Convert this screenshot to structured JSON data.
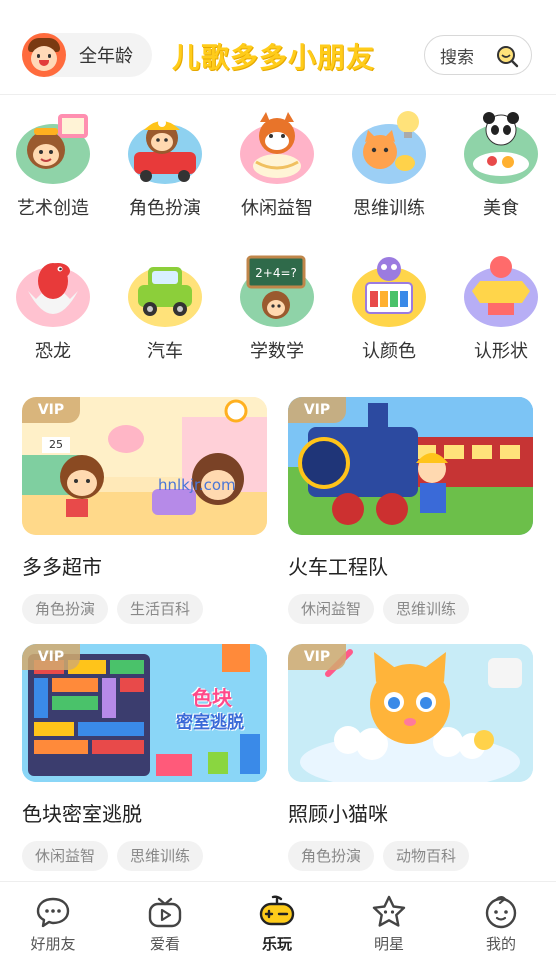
{
  "header": {
    "age_label": "全年龄",
    "app_title": "儿歌多多小朋友",
    "search_label": "搜索"
  },
  "categories": [
    {
      "label": "艺术创造",
      "icon": "monkey-painting-icon"
    },
    {
      "label": "角色扮演",
      "icon": "monkey-firefighter-icon"
    },
    {
      "label": "休闲益智",
      "icon": "red-panda-noodles-icon"
    },
    {
      "label": "思维训练",
      "icon": "cat-lightbulb-icon"
    },
    {
      "label": "美食",
      "icon": "panda-food-icon"
    },
    {
      "label": "恐龙",
      "icon": "dinosaur-egg-icon"
    },
    {
      "label": "汽车",
      "icon": "green-car-icon"
    },
    {
      "label": "学数学",
      "icon": "math-board-icon"
    },
    {
      "label": "认颜色",
      "icon": "color-palette-icon"
    },
    {
      "label": "认形状",
      "icon": "shapes-robot-icon"
    }
  ],
  "cards": [
    {
      "title": "多多超市",
      "badge": "VIP",
      "tags": [
        "角色扮演",
        "生活百科"
      ],
      "watermark": "hnlkjr.com",
      "price_tag": "25"
    },
    {
      "title": "火车工程队",
      "badge": "VIP",
      "tags": [
        "休闲益智",
        "思维训练"
      ]
    },
    {
      "title": "色块密室逃脱",
      "badge": "VIP",
      "tags": [
        "休闲益智",
        "思维训练"
      ],
      "art_text_1": "色块",
      "art_text_2": "密室逃脱"
    },
    {
      "title": "照顾小猫咪",
      "badge": "VIP",
      "tags": [
        "角色扮演",
        "动物百科"
      ]
    }
  ],
  "nav": [
    {
      "label": "好朋友",
      "icon": "chat-bubble-icon",
      "active": false
    },
    {
      "label": "爱看",
      "icon": "tv-icon",
      "active": false
    },
    {
      "label": "乐玩",
      "icon": "gamepad-icon",
      "active": true
    },
    {
      "label": "明星",
      "icon": "star-icon",
      "active": false
    },
    {
      "label": "我的",
      "icon": "baby-face-icon",
      "active": false
    }
  ],
  "colors": {
    "brand_yellow": "#ffcc1a",
    "text_primary": "#222222",
    "tag_bg": "#f2f2f2",
    "vip_badge": "#d2aa6e"
  }
}
